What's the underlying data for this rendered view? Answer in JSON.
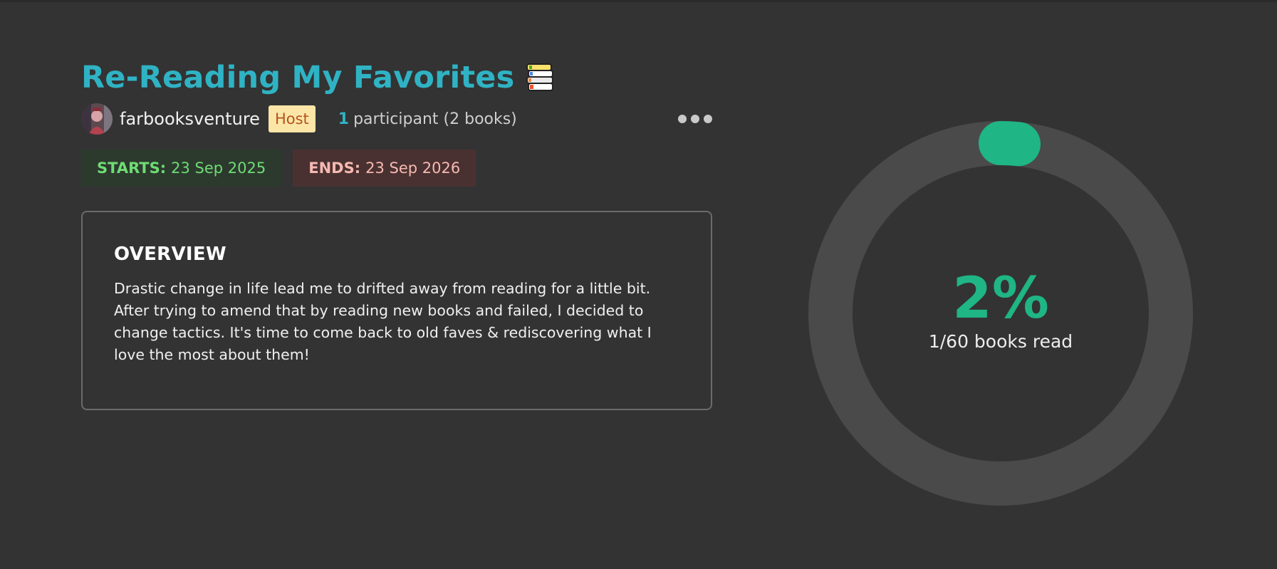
{
  "challenge": {
    "title": "Re-Reading My Favorites",
    "title_icon": "books-stack-icon"
  },
  "host": {
    "username": "farbooksventure",
    "badge": "Host"
  },
  "participants": {
    "count": "1",
    "label": "participant (2 books)"
  },
  "menu": {
    "icon": "more-horizontal-icon"
  },
  "dates": {
    "start_label": "STARTS:",
    "start_value": "23 Sep 2025",
    "end_label": "ENDS:",
    "end_value": "23 Sep 2026"
  },
  "overview": {
    "heading": "OVERVIEW",
    "text": "Drastic change in life lead me to drifted away from reading for a little bit. After trying to amend that by reading new books and failed, I decided to change tactics. It's time to come back to old faves & rediscovering what I love the most about them!"
  },
  "progress": {
    "percent_label": "2%",
    "fraction": 0.0167,
    "books_read_label": "1/60 books read"
  },
  "colors": {
    "background": "#333333",
    "title": "#2fb3c4",
    "progress_accent": "#1fb584",
    "ring_track": "#4a4a4a",
    "start_text": "#6fdc74",
    "end_text": "#f6b9b2",
    "host_badge_bg": "#fbe6a8"
  }
}
